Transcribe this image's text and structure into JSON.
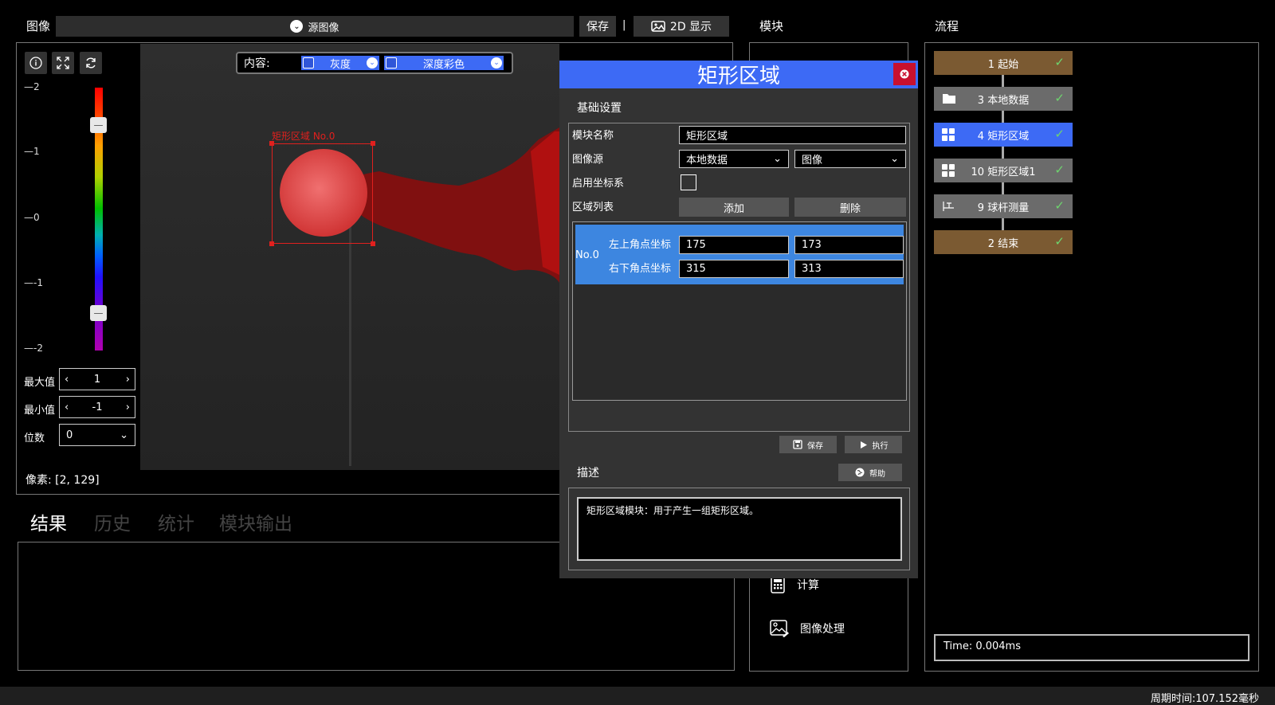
{
  "image_panel": {
    "title": "图像",
    "source_label": "源图像",
    "save_label": "保存",
    "separator": "|",
    "display_label": "2D 显示",
    "content_label": "内容:",
    "gray_label": "灰度",
    "depth_label": "深度彩色",
    "roi_label": "矩形区域 No.0",
    "pixel_readout": "像素: [2, 129]",
    "colorbar_ticks": [
      "2",
      "1",
      "0",
      "-1",
      "-2"
    ],
    "max_label": "最大值",
    "max_value": "1",
    "min_label": "最小值",
    "min_value": "-1",
    "digits_label": "位数",
    "digits_value": "0"
  },
  "result_tabs": [
    "结果",
    "历史",
    "统计",
    "模块输出"
  ],
  "modules_panel": {
    "title": "模块",
    "items": [
      {
        "label": "计算",
        "icon": "calculator-icon"
      },
      {
        "label": "图像处理",
        "icon": "image-edit-icon"
      }
    ]
  },
  "flow_panel": {
    "title": "流程",
    "nodes": [
      {
        "label": "1 起始",
        "color": "#7b5a32",
        "icon": ""
      },
      {
        "label": "3 本地数据",
        "color": "#6b6b6b",
        "icon": "folder-icon"
      },
      {
        "label": "4 矩形区域",
        "color": "#3d6af5",
        "icon": "grid-icon"
      },
      {
        "label": "10 矩形区域1",
        "color": "#6b6b6b",
        "icon": "grid-icon"
      },
      {
        "label": "9 球杆测量",
        "color": "#6b6b6b",
        "icon": "measure-icon"
      },
      {
        "label": "2 结束",
        "color": "#7b5a32",
        "icon": ""
      }
    ],
    "time_text": "Time: 0.004ms"
  },
  "dialog": {
    "title": "矩形区域",
    "section_basic": "基础设置",
    "module_name_label": "模块名称",
    "module_name_value": "矩形区域",
    "image_source_label": "图像源",
    "image_source_value1": "本地数据",
    "image_source_value2": "图像",
    "coord_label": "启用坐标系",
    "region_list_label": "区域列表",
    "add_label": "添加",
    "delete_label": "删除",
    "region": {
      "name": "No.0",
      "top_left_label": "左上角点坐标",
      "top_left_x": "175",
      "top_left_y": "173",
      "bottom_right_label": "右下角点坐标",
      "bottom_right_x": "315",
      "bottom_right_y": "313"
    },
    "save_label": "保存",
    "run_label": "执行",
    "section_desc": "描述",
    "help_label": "帮助",
    "description": "矩形区域模块：用于产生一组矩形区域。"
  },
  "status_bar": {
    "cycle_time": "周期时间:107.152毫秒"
  },
  "colors": {
    "accent": "#3d6af5",
    "flow_start_end": "#7b5a32",
    "flow_module": "#6b6b6b",
    "roi": "#e0201e",
    "close": "#c8102e"
  }
}
